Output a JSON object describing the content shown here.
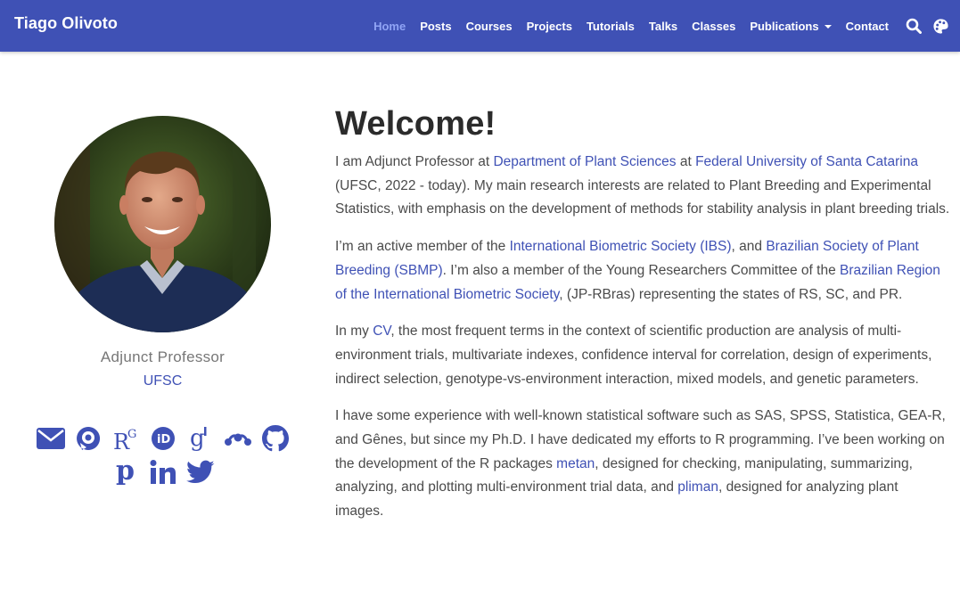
{
  "navbar": {
    "brand": "Tiago Olivoto",
    "items": [
      {
        "label": "Home",
        "active": true
      },
      {
        "label": "Posts"
      },
      {
        "label": "Courses"
      },
      {
        "label": "Projects"
      },
      {
        "label": "Tutorials"
      },
      {
        "label": "Talks"
      },
      {
        "label": "Classes"
      },
      {
        "label": "Publications",
        "dropdown": true
      },
      {
        "label": "Contact"
      }
    ],
    "icons": [
      "search-icon",
      "palette-icon"
    ],
    "color": "#3f51b5"
  },
  "profile": {
    "role": "Adjunct Professor",
    "organization": "UFSC",
    "social_icons": [
      "envelope-icon",
      "lattes-icon",
      "researchgate-icon",
      "orcid-icon",
      "google-scholar-icon",
      "mendeley-icon",
      "github-icon",
      "publons-icon",
      "linkedin-icon",
      "twitter-icon"
    ]
  },
  "main": {
    "heading": "Welcome!",
    "p1": {
      "t1": "I am Adjunct Professor at ",
      "l1": "Department of Plant Sciences",
      "t2": " at ",
      "l2": "Federal University of Santa Catarina",
      "t3": " (UFSC, 2022 - today). My main research interests are related to Plant Breeding and Experimental Statistics, with emphasis on the development of methods for stability analysis in plant breeding trials."
    },
    "p2": {
      "t1": "I’m an active member of the ",
      "l1": "International Biometric Society (IBS)",
      "t2": ", and ",
      "l2": "Brazilian Society of Plant Breeding (SBMP)",
      "t3": ". I’m also a member of the Young Researchers Committee of the ",
      "l3": "Brazilian Region of the International Biometric Society",
      "t4": ", (JP-RBras) representing the states of RS, SC, and PR."
    },
    "p3": {
      "t1": "In my ",
      "l1": "CV",
      "t2": ", the most frequent terms in the context of scientific production are analysis of multi-environment trials, multivariate indexes, confidence interval for correlation, design of experiments, indirect selection, genotype-vs-environment interaction, mixed models, and genetic parameters."
    },
    "p4": {
      "t1": "I have some experience with well-known statistical software such as SAS, SPSS, Statistica, GEA-R, and Gênes, but since my Ph.D. I have dedicated my efforts to R programming. I’ve been working on the development of the R packages ",
      "l1": "metan",
      "t2": ", designed for checking, manipulating, summarizing, analyzing, and plotting multi-environment trial data, and ",
      "l2": "pliman",
      "t3": ", designed for analyzing plant images."
    }
  }
}
